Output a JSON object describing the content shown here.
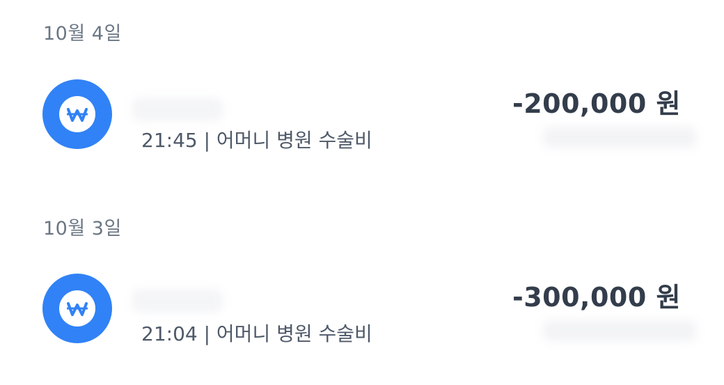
{
  "transactions": [
    {
      "date": "10월 4일",
      "icon": "won-icon",
      "meta": "21:45 | 어머니 병원 수술비",
      "amount": "-200,000 원"
    },
    {
      "date": "10월 3일",
      "icon": "won-icon",
      "meta": "21:04 | 어머니 병원 수술비",
      "amount": "-300,000 원"
    }
  ],
  "colors": {
    "accent": "#3182f6",
    "amount_text": "#333d4b",
    "date_text": "#6b7684",
    "meta_text": "#4e5968"
  }
}
